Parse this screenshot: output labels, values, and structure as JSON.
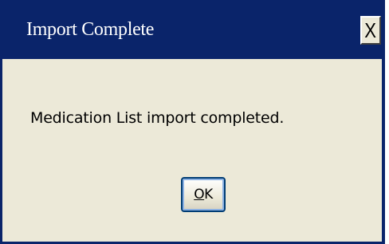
{
  "window": {
    "title": "Import Complete",
    "close_label": "X"
  },
  "dialog": {
    "message": "Medication List import completed.",
    "ok_button": {
      "mnemonic": "O",
      "rest": "K"
    }
  },
  "colors": {
    "titlebar": "#0a246a",
    "title_text": "#ffffff",
    "dialog_background": "#ece9d8"
  }
}
